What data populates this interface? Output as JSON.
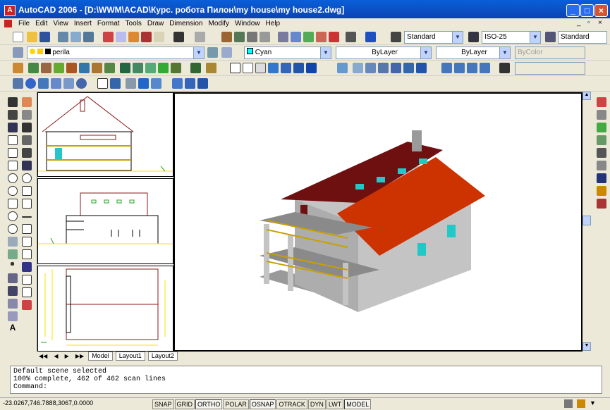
{
  "window": {
    "title": "AutoCAD 2006 - [D:\\WWM\\ACAD\\Курс. робота Пилон\\my house\\my house2.dwg]",
    "min": "_",
    "max": "□",
    "close": "×"
  },
  "menu": [
    "File",
    "Edit",
    "View",
    "Insert",
    "Format",
    "Tools",
    "Draw",
    "Dimension",
    "Modify",
    "Window",
    "Help"
  ],
  "toolbar": {
    "text_style": "Standard",
    "dim_style": "ISO-25",
    "table_style": "Standard",
    "layer": "perila",
    "color": "Cyan",
    "linetype": "ByLayer",
    "lineweight": "ByLayer",
    "plotstyle": "ByColor"
  },
  "layout_tabs": [
    "Model",
    "Layout1",
    "Layout2"
  ],
  "command_lines": [
    "Default scene selected",
    "100% complete, 462 of 462 scan lines",
    "Command:"
  ],
  "status": {
    "coords": "-23.0267,746.7888,3067,0.0000",
    "buttons": [
      {
        "label": "SNAP",
        "on": false
      },
      {
        "label": "GRID",
        "on": false
      },
      {
        "label": "ORTHO",
        "on": true
      },
      {
        "label": "POLAR",
        "on": false
      },
      {
        "label": "OSNAP",
        "on": true
      },
      {
        "label": "OTRACK",
        "on": false
      },
      {
        "label": "DYN",
        "on": false
      },
      {
        "label": "LWT",
        "on": false
      },
      {
        "label": "MODEL",
        "on": true
      }
    ]
  },
  "colors": {
    "roof": "#cc3300",
    "roof_dark": "#6e1010",
    "wall": "#c0c0c0",
    "window": "#20c8c8",
    "accent": "#0a50c8"
  }
}
